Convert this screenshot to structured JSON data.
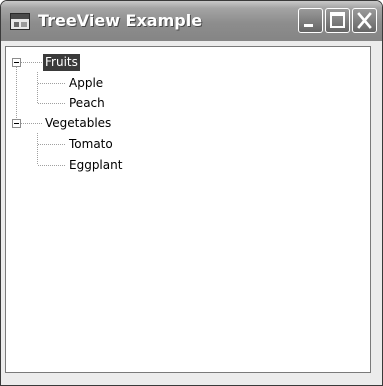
{
  "window": {
    "title": "TreeView Example",
    "app_icon": "form-window-icon",
    "controls": [
      "minimize-icon",
      "maximize-icon",
      "close-icon"
    ]
  },
  "tree": {
    "nodes": [
      {
        "label": "Fruits",
        "expanded": true,
        "selected": true,
        "children": [
          {
            "label": "Apple"
          },
          {
            "label": "Peach"
          }
        ]
      },
      {
        "label": "Vegetables",
        "expanded": true,
        "selected": false,
        "children": [
          {
            "label": "Tomato"
          },
          {
            "label": "Eggplant"
          }
        ]
      }
    ]
  },
  "colors": {
    "selection": "#3a3a3a",
    "titlebar": "#8d8d8d"
  }
}
